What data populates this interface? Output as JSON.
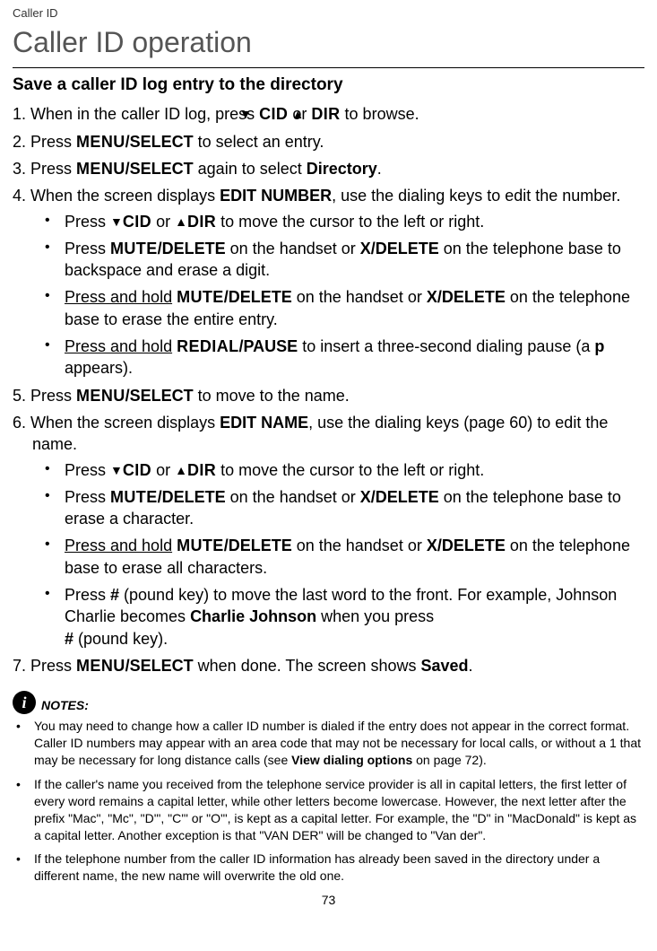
{
  "eyebrow": "Caller ID",
  "title": "Caller ID operation",
  "section_heading": "Save a caller ID log entry to the directory",
  "steps": {
    "s1_a": "1. When in the caller ID log, press ",
    "s1_b": " or ",
    "s1_c": " to browse.",
    "cid": "CID",
    "dir": "DIR",
    "s2_a": "2. Press ",
    "menu": "MENU",
    "select": "/SELECT",
    "s2_b": " to select an entry.",
    "s3_a": "3. Press ",
    "s3_b": " again to select ",
    "directory": "Directory",
    "s3_c": ".",
    "s4_a": "4. When the screen displays ",
    "edit_number": "EDIT NUMBER",
    "s4_b": ", use the dialing keys to edit the number.",
    "sub4_1_a": "Press ",
    "sub4_1_b": " or ",
    "sub4_1_c": " to move the cursor to the left or right.",
    "sub4_2_a": "Press ",
    "mute": "MUTE",
    "delete": "/DELETE",
    "sub4_2_b": " on the handset or ",
    "xdelete": "X/DELETE",
    "sub4_2_c": " on the telephone base to backspace and erase a digit.",
    "press_hold": "Press and hold",
    "sub4_3_b": " on the handset or ",
    "sub4_3_c": " on the telephone base to erase the entire entry.",
    "redial": "REDIAL",
    "pause": "/PAUSE",
    "sub4_4_b": " to insert a three-second dialing pause (a ",
    "p": "p",
    "sub4_4_c": " appears).",
    "s5_a": "5. Press ",
    "s5_b": " to move to the name.",
    "s6_a": "6. When the screen displays ",
    "edit_name": "EDIT NAME",
    "s6_b": ", use the dialing keys (page 60) to edit the name.",
    "sub6_2_c": " on the telephone base to erase a character.",
    "sub6_3_c": " on the telephone base to erase all characters.",
    "sub6_4_a": "Press ",
    "hash": "#",
    "sub6_4_b": " (pound key) to move the last word to the front. For example, Johnson Charlie becomes ",
    "charlie": "Charlie Johnson",
    "sub6_4_c": " when you press ",
    "sub6_4_d": " (pound key).",
    "s7_a": "7. Press ",
    "s7_b": " when done. The screen shows ",
    "saved": "Saved",
    "s7_c": "."
  },
  "notes_label": "NOTES:",
  "notes": {
    "n1_a": "You may need to change how a caller ID number is dialed if the entry does not appear in the correct format. Caller ID numbers may appear with an area code that may not be necessary for local calls, or without a 1 that may be necessary for long distance calls (see ",
    "n1_b": "View dialing options",
    "n1_c": " on page 72).",
    "n2": "If the caller's name you received from the telephone service provider is all in capital letters, the first letter of every word remains a capital letter, while other letters become lowercase. However, the next letter after the prefix \"Mac\", \"Mc\", \"D'\", \"C'\" or \"O'\", is kept as a capital letter. For example, the \"D\" in \"MacDonald\" is kept as a capital letter. Another exception is that \"VAN DER\" will be changed to \"Van der\".",
    "n3": "If the telephone number from the caller ID information has already been saved in the directory under a different name, the new name will overwrite the old one."
  },
  "page_number": "73"
}
